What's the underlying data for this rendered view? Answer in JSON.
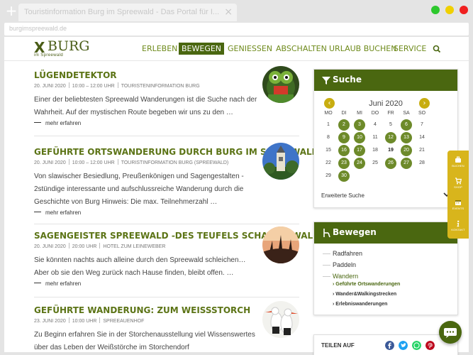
{
  "browser": {
    "new_tab": "+",
    "tab_title": "Touristinformation Burg im Spreewald - Das Portal für I...",
    "tab_close": "×",
    "address": "burgimspreewald.de"
  },
  "logo": {
    "mark": "X",
    "name": "BURG",
    "sub": "im Spreewald"
  },
  "nav": {
    "items": [
      "ERLEBEN",
      "BEWEGEN",
      "GENIESSEN",
      "ABSCHALTEN",
      "URLAUB BUCHEN",
      "SERVICE"
    ],
    "active": "BEWEGEN",
    "search_icon": "search-icon"
  },
  "articles": [
    {
      "title": "LÜGENDETEKTOR",
      "date": "20. JUNI 2020",
      "time": "10:00 – 12:00 UHR",
      "org": "TOURISTENINFORMATION BURG",
      "desc": "Einer der beliebtesten Spreewald Wanderungen ist die Suche nach der Wahrheit. Auf der mystischen Route begeben wir uns zu den …",
      "more": "mehr erfahren"
    },
    {
      "title": "GEFÜHRTE ORTSWANDERUNG DURCH BURG IM SPREEWALD",
      "date": "20. JUNI 2020",
      "time": "10:00 – 12:00 UHR",
      "org": "TOURISTINFORMATION BURG (SPREEWALD)",
      "desc": "Von slawischer Besiedlung, Preußenkönigen und Sagengestalten - 2stündige interessante und aufschlussreiche Wanderung durch die Geschichte von Burg Hinweis: Die max. Teilnehmerzahl …",
      "more": "mehr erfahren"
    },
    {
      "title": "SAGENGEISTER SPREEWALD -DES TEUFELS SCHATTENWALD",
      "date": "20. JUNI 2020",
      "time": "20:00 UHR",
      "org": "HOTEL ZUM LEINEWEBER",
      "desc": "Sie könnten nachts auch alleine durch den Spreewald schleichen… Aber ob sie den Weg zurück nach Hause finden, bleibt offen. …",
      "more": "mehr erfahren"
    },
    {
      "title": "GEFÜHRTE WANDERUNG: ZUM WEISSSTORCH",
      "date": "23. JUNI 2020",
      "time": "10:00 UHR",
      "org": "SPREEAUENHOF",
      "desc": "Zu Beginn erfahren Sie in der Storchenausstellung viel Wissenswertes über das Leben der Weißstörche im Storchendorf",
      "more": ""
    }
  ],
  "search_widget": {
    "title": "Suche",
    "month": "Juni 2020",
    "prev": "‹",
    "next": "›",
    "weekdays": [
      "MO",
      "DI",
      "MI",
      "DO",
      "FR",
      "SA",
      "SO"
    ],
    "days": [
      [
        "1",
        "2",
        "3",
        "4",
        "5",
        "6",
        "7"
      ],
      [
        "8",
        "9",
        "10",
        "11",
        "12",
        "13",
        "14"
      ],
      [
        "15",
        "16",
        "17",
        "18",
        "19",
        "20",
        "21"
      ],
      [
        "22",
        "23",
        "24",
        "25",
        "26",
        "27",
        "28"
      ],
      [
        "29",
        "30",
        "",
        "",
        "",
        "",
        ""
      ]
    ],
    "available": [
      "2",
      "3",
      "6",
      "9",
      "10",
      "12",
      "13",
      "16",
      "17",
      "20",
      "23",
      "24",
      "26",
      "27",
      "30"
    ],
    "today": "19",
    "advanced": "Erweiterte Suche"
  },
  "bewegen_widget": {
    "title": "Bewegen",
    "items": [
      "Radfahren",
      "Paddeln",
      "Wandern"
    ],
    "active": "Wandern",
    "subitems": [
      "Geführte Ortswanderungen",
      "Wander&Walkingstrecken",
      "Erlebniswanderungen"
    ],
    "active_sub": "Geführte Ortswanderungen"
  },
  "share": {
    "label": "TEILEN AUF",
    "icons": [
      "facebook-icon",
      "twitter-icon",
      "whatsapp-icon",
      "pinterest-icon"
    ]
  },
  "float_bar": {
    "items": [
      "BUCHEN",
      "SHOP",
      "EVENTS",
      "KONTAKT"
    ]
  },
  "colors": {
    "brand_green": "#4a6710",
    "link_green": "#6e8a1b",
    "accent_yellow": "#d8b51c",
    "calendar_green": "#6d8a2a"
  }
}
